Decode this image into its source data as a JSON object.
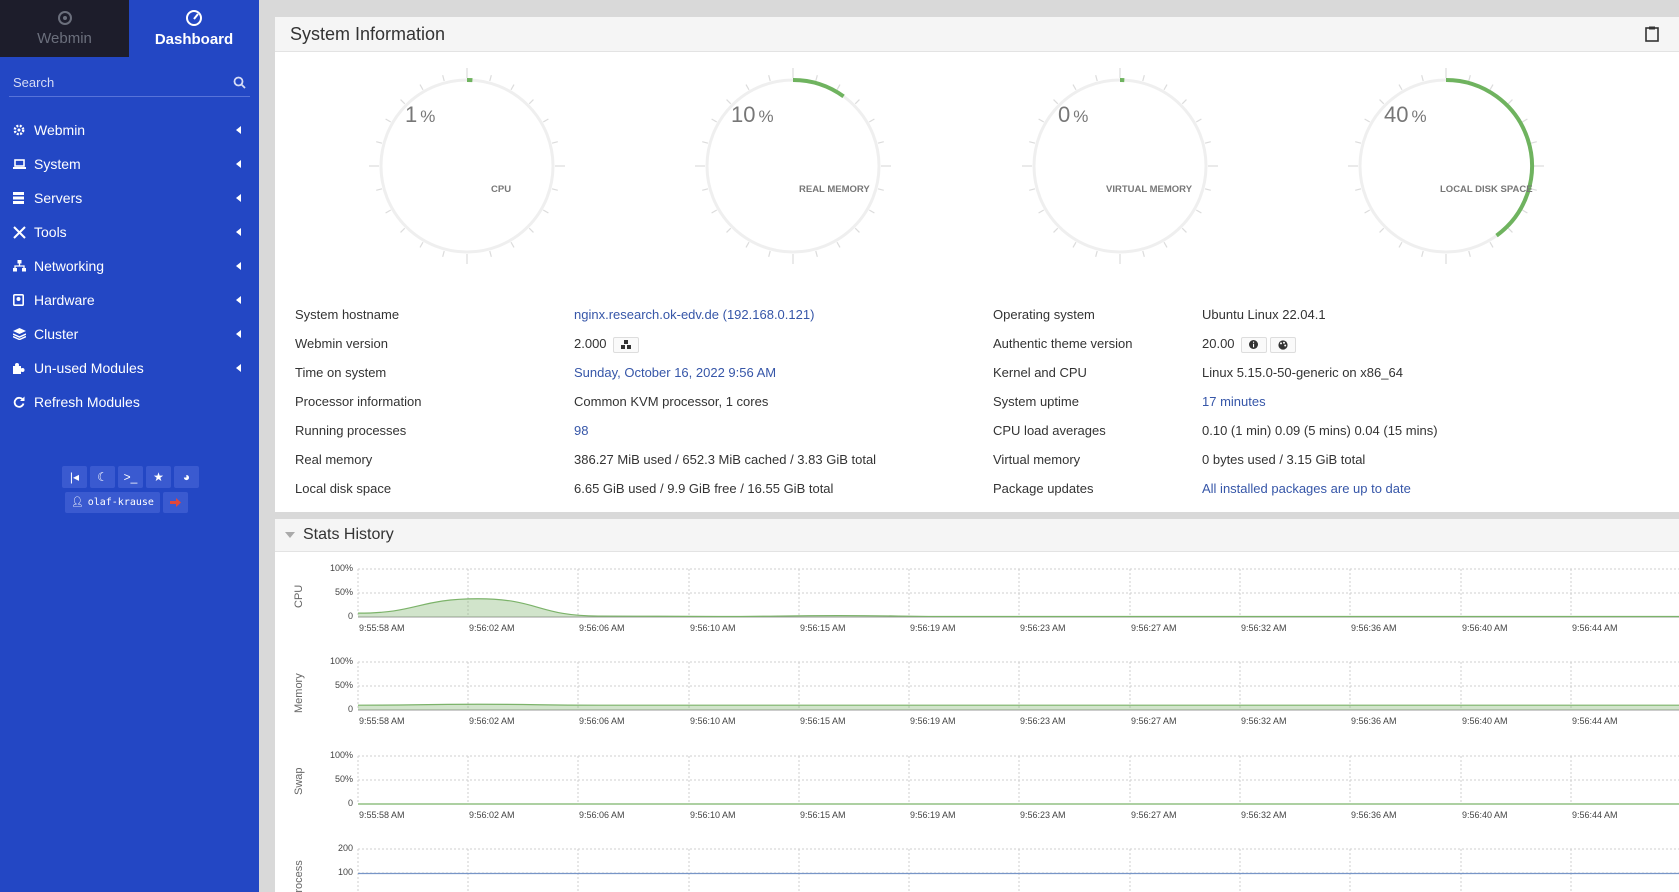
{
  "sidebar": {
    "tabs": [
      {
        "label": "Webmin",
        "icon": "webmin-logo-icon"
      },
      {
        "label": "Dashboard",
        "icon": "dashboard-icon"
      }
    ],
    "search_placeholder": "Search",
    "menu": [
      {
        "label": "Webmin",
        "icon": "gear-icon"
      },
      {
        "label": "System",
        "icon": "laptop-icon"
      },
      {
        "label": "Servers",
        "icon": "server-icon"
      },
      {
        "label": "Tools",
        "icon": "tools-icon"
      },
      {
        "label": "Networking",
        "icon": "network-icon"
      },
      {
        "label": "Hardware",
        "icon": "hardware-icon"
      },
      {
        "label": "Cluster",
        "icon": "layers-icon"
      },
      {
        "label": "Un-used Modules",
        "icon": "puzzle-icon"
      },
      {
        "label": "Refresh Modules",
        "icon": "refresh-icon"
      }
    ],
    "username": "olaf-krause"
  },
  "system_info": {
    "title": "System Information",
    "gauges": [
      {
        "value": "1",
        "unit": "%",
        "label": "CPU",
        "fraction": 0.01
      },
      {
        "value": "10",
        "unit": "%",
        "label": "REAL MEMORY",
        "fraction": 0.1
      },
      {
        "value": "0",
        "unit": "%",
        "label": "VIRTUAL MEMORY",
        "fraction": 0.0
      },
      {
        "value": "40",
        "unit": "%",
        "label": "LOCAL DISK SPACE",
        "fraction": 0.4
      }
    ],
    "left": [
      {
        "label": "System hostname",
        "value": "nginx.research.ok-edv.de (192.168.0.121)"
      },
      {
        "label": "Webmin version",
        "value": "2.000"
      },
      {
        "label": "Time on system",
        "value": "Sunday, October 16, 2022 9:56 AM"
      },
      {
        "label": "Processor information",
        "value": "Common KVM processor, 1 cores"
      },
      {
        "label": "Running processes",
        "value": "98"
      },
      {
        "label": "Real memory",
        "value": "386.27 MiB used / 652.3 MiB cached / 3.83 GiB total"
      },
      {
        "label": "Local disk space",
        "value": "6.65 GiB used / 9.9 GiB free / 16.55 GiB total"
      }
    ],
    "right": [
      {
        "label": "Operating system",
        "value": "Ubuntu Linux 22.04.1"
      },
      {
        "label": "Authentic theme version",
        "value": "20.00"
      },
      {
        "label": "Kernel and CPU",
        "value": "Linux 5.15.0-50-generic on x86_64"
      },
      {
        "label": "System uptime",
        "value": "17 minutes"
      },
      {
        "label": "CPU load averages",
        "value": "0.10 (1 min) 0.09 (5 mins) 0.04 (15 mins)"
      },
      {
        "label": "Virtual memory",
        "value": "0 bytes used / 3.15 GiB total"
      },
      {
        "label": "Package updates",
        "value": "All installed packages are up to date"
      }
    ]
  },
  "stats_history": {
    "title": "Stats History"
  },
  "chart_data": [
    {
      "type": "area",
      "ylabel": "CPU",
      "yticks": [
        "100%",
        "50%",
        "0"
      ],
      "x": [
        "9:55:58 AM",
        "9:56:02 AM",
        "9:56:06 AM",
        "9:56:10 AM",
        "9:56:15 AM",
        "9:56:19 AM",
        "9:56:23 AM",
        "9:56:27 AM",
        "9:56:32 AM",
        "9:56:36 AM",
        "9:56:40 AM",
        "9:56:44 AM"
      ],
      "values": [
        8,
        38,
        2,
        1,
        3,
        1,
        1,
        1,
        1,
        1,
        1,
        1
      ],
      "ylim": [
        0,
        100
      ],
      "color": "#7cb36a"
    },
    {
      "type": "area",
      "ylabel": "Memory",
      "yticks": [
        "100%",
        "50%",
        "0"
      ],
      "x": [
        "9:55:58 AM",
        "9:56:02 AM",
        "9:56:06 AM",
        "9:56:10 AM",
        "9:56:15 AM",
        "9:56:19 AM",
        "9:56:23 AM",
        "9:56:27 AM",
        "9:56:32 AM",
        "9:56:36 AM",
        "9:56:40 AM",
        "9:56:44 AM"
      ],
      "values": [
        10,
        12,
        10,
        10,
        10,
        10,
        10,
        10,
        10,
        10,
        10,
        10
      ],
      "ylim": [
        0,
        100
      ],
      "color": "#7cb36a"
    },
    {
      "type": "area",
      "ylabel": "Swap",
      "yticks": [
        "100%",
        "50%",
        "0"
      ],
      "x": [
        "9:55:58 AM",
        "9:56:02 AM",
        "9:56:06 AM",
        "9:56:10 AM",
        "9:56:15 AM",
        "9:56:19 AM",
        "9:56:23 AM",
        "9:56:27 AM",
        "9:56:32 AM",
        "9:56:36 AM",
        "9:56:40 AM",
        "9:56:44 AM"
      ],
      "values": [
        0,
        0,
        0,
        0,
        0,
        0,
        0,
        0,
        0,
        0,
        0,
        0
      ],
      "ylim": [
        0,
        100
      ],
      "color": "#7cb36a"
    },
    {
      "type": "line",
      "ylabel": "Process",
      "yticks": [
        "200",
        "100"
      ],
      "x": [],
      "values": [
        98,
        98,
        98,
        98,
        98,
        98,
        98,
        98,
        98,
        98,
        98,
        98
      ],
      "ylim": [
        0,
        200
      ],
      "color": "#7896c8"
    }
  ]
}
